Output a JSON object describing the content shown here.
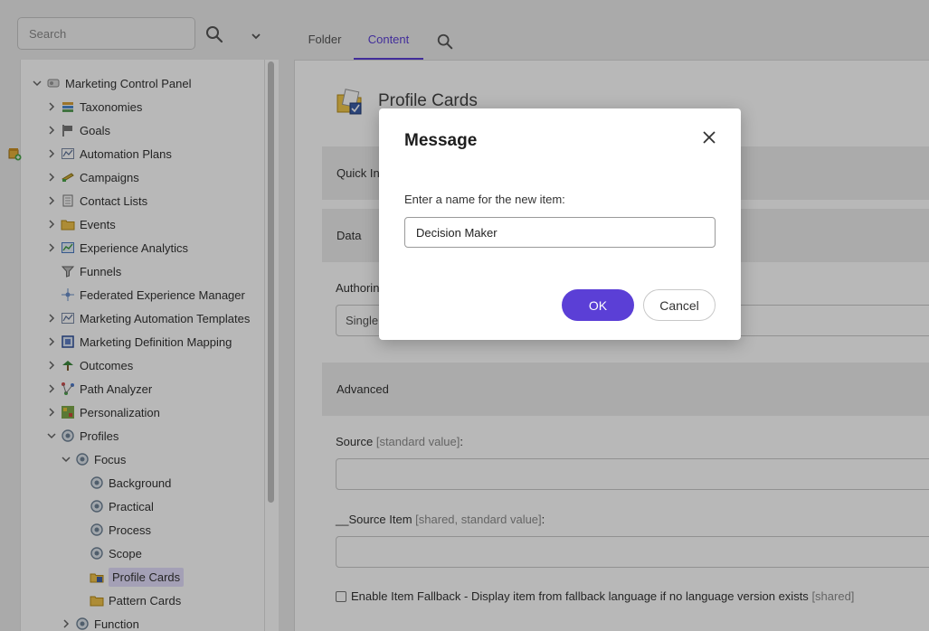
{
  "search": {
    "placeholder": "Search",
    "search_icon": "search-icon",
    "dropdown_icon": "chevron-down-icon"
  },
  "tree": {
    "items": [
      {
        "label": "Marketing Control Panel",
        "icon": "control-panel-icon",
        "expand": "expanded"
      },
      {
        "label": "Taxonomies",
        "icon": "books-icon",
        "expand": "collapsed"
      },
      {
        "label": "Goals",
        "icon": "flag-icon",
        "expand": "collapsed"
      },
      {
        "label": "Automation Plans",
        "icon": "automation-icon",
        "expand": "collapsed"
      },
      {
        "label": "Campaigns",
        "icon": "campaign-icon",
        "expand": "collapsed"
      },
      {
        "label": "Contact Lists",
        "icon": "contact-list-icon",
        "expand": "collapsed"
      },
      {
        "label": "Events",
        "icon": "folder-icon",
        "expand": "collapsed"
      },
      {
        "label": "Experience Analytics",
        "icon": "chart-icon",
        "expand": "collapsed"
      },
      {
        "label": "Funnels",
        "icon": "funnel-icon",
        "expand": "none"
      },
      {
        "label": "Federated Experience Manager",
        "icon": "federated-icon",
        "expand": "none"
      },
      {
        "label": "Marketing Automation Templates",
        "icon": "automation-icon",
        "expand": "collapsed"
      },
      {
        "label": "Marketing Definition Mapping",
        "icon": "mapping-icon",
        "expand": "collapsed"
      },
      {
        "label": "Outcomes",
        "icon": "outcome-icon",
        "expand": "collapsed"
      },
      {
        "label": "Path Analyzer",
        "icon": "path-analyzer-icon",
        "expand": "collapsed"
      },
      {
        "label": "Personalization",
        "icon": "personalization-icon",
        "expand": "collapsed"
      },
      {
        "label": "Profiles",
        "icon": "profile-gear-icon",
        "expand": "expanded"
      },
      {
        "label": "Focus",
        "icon": "profile-gear-icon",
        "expand": "expanded"
      },
      {
        "label": "Background",
        "icon": "profile-gear-icon",
        "expand": "none"
      },
      {
        "label": "Practical",
        "icon": "profile-gear-icon",
        "expand": "none"
      },
      {
        "label": "Process",
        "icon": "profile-gear-icon",
        "expand": "none"
      },
      {
        "label": "Scope",
        "icon": "profile-gear-icon",
        "expand": "none"
      },
      {
        "label": "Profile Cards",
        "icon": "profile-card-folder-icon",
        "expand": "none",
        "selected": true
      },
      {
        "label": "Pattern Cards",
        "icon": "folder-icon",
        "expand": "none"
      },
      {
        "label": "Function",
        "icon": "profile-gear-icon",
        "expand": "collapsed"
      }
    ]
  },
  "tabs": {
    "folder": "Folder",
    "content": "Content",
    "search_icon": "search-icon"
  },
  "item": {
    "title": "Profile Cards",
    "icon": "profile-card-folder-icon"
  },
  "sections": {
    "quick_info": "Quick Info",
    "data": "Data",
    "advanced": "Advanced"
  },
  "fields": {
    "authoring_label": "Authoring",
    "authoring_value": "Single",
    "source_label": "Source",
    "source_meta": "[standard value]",
    "source_item_label": "__Source Item",
    "source_item_meta": "[shared, standard value]",
    "fallback_label": "Enable Item Fallback - Display item from fallback language if no language version exists",
    "fallback_meta": "[shared]",
    "colon": ":"
  },
  "dialog": {
    "title": "Message",
    "prompt": "Enter a name for the new item:",
    "input_value": "Decision Maker",
    "ok_label": "OK",
    "cancel_label": "Cancel",
    "close_icon": "close-icon"
  },
  "colors": {
    "accent": "#5b3fd6",
    "selection": "#e4defc"
  }
}
